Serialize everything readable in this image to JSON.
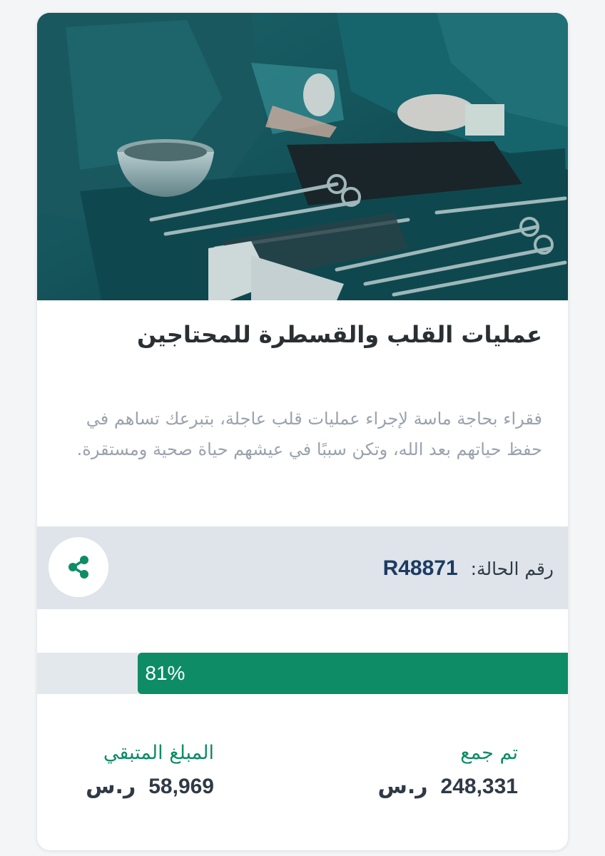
{
  "campaign": {
    "image_alt": "surgical instruments in operating room",
    "title": "عمليات القلب والقسطرة للمحتاجين",
    "description": "فقراء بحاجة ماسة لإجراء عمليات قلب عاجلة، بتبرعك تساهم في حفظ حياتهم بعد الله، وتكن سببًا في عيشهم حياة صحية ومستقرة."
  },
  "case": {
    "label": "رقم الحالة:",
    "number": "R48871",
    "share_icon": "share-icon"
  },
  "progress": {
    "percent_text": "81%",
    "fraction": 0.81
  },
  "stats": {
    "collected_label": "تم جمع",
    "collected_value": "248,331",
    "remaining_label": "المبلغ المتبقي",
    "remaining_value": "58,969",
    "currency": "ر.س"
  },
  "colors": {
    "accent": "#0e8c66",
    "case_bar": "#dfe4ea",
    "case_number": "#1d3b63"
  }
}
